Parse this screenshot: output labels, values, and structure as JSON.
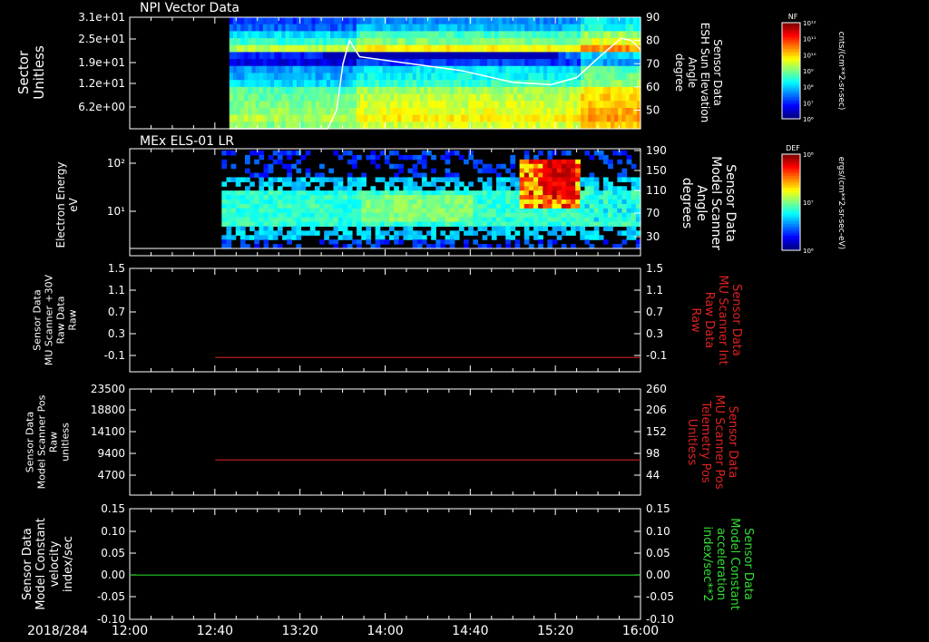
{
  "colors": {
    "background": "#000000",
    "frame": "#ffffff",
    "text": "#ffffff",
    "red_trace": "#cc2020",
    "green_trace": "#22cc22"
  },
  "time_axis": {
    "date_label": "2018/284",
    "ticks": [
      "12:00",
      "12:40",
      "13:20",
      "14:00",
      "14:40",
      "15:20",
      "16:00"
    ],
    "tick_hours": [
      12.0,
      12.6667,
      13.3333,
      14.0,
      14.6667,
      15.3333,
      16.0
    ],
    "range_hours": [
      12.0,
      16.0
    ]
  },
  "chart_data": [
    {
      "type": "heatmap",
      "title": "NPI Vector Data",
      "ylabel_left": [
        "Sector",
        "Unitless"
      ],
      "yticks_left": [
        "3.1e+01",
        "2.5e+01",
        "1.9e+01",
        "1.2e+01",
        "6.2e+00"
      ],
      "ylabel_right": [
        "Sensor Data",
        "ESH Sun Elevation",
        "Angle",
        "degree"
      ],
      "yticks_right": [
        "90",
        "80",
        "70",
        "60",
        "50"
      ],
      "ylim_right": [
        42,
        90
      ],
      "data_start_hour": 12.78,
      "overlay_line": {
        "name": "ESH Sun Elevation Angle",
        "color": "#ffffff",
        "x_hours": [
          12.78,
          13.3,
          13.55,
          13.62,
          13.67,
          13.72,
          13.8,
          14.2,
          14.6,
          15.0,
          15.3,
          15.5,
          15.7,
          15.85,
          15.93,
          16.0
        ],
        "y_degrees": [
          42,
          42,
          42,
          50,
          70,
          80,
          73,
          70,
          67,
          62,
          61,
          64,
          74,
          81,
          80,
          76
        ]
      },
      "colorbar": {
        "label": "NF",
        "tick_labels": [
          "10¹²",
          "10¹¹",
          "10¹⁰",
          "10⁹",
          "10⁸",
          "10⁷",
          "10⁶"
        ],
        "units": "cnts/(cm**2-sr-sec)"
      }
    },
    {
      "type": "heatmap",
      "title": "MEx ELS-01 LR",
      "ylabel_left": [
        "Electron Energy",
        "eV"
      ],
      "yticks_left": [
        "10²",
        "10¹"
      ],
      "ylabel_right": [
        "Sensor Data",
        "Model Scanner",
        "Angle",
        "degrees"
      ],
      "yticks_right": [
        "190",
        "150",
        "110",
        "70",
        "30"
      ],
      "data_start_hour": 12.72,
      "colorbar": {
        "label": "DEF",
        "tick_labels": [
          "10⁸",
          "10⁷",
          "10⁶"
        ],
        "units": "ergs/(cm**2-sr-sec-eV)"
      }
    },
    {
      "type": "line",
      "ylabel_left": [
        "Sensor Data",
        "MU Scanner +30V",
        "Raw Data",
        "Raw"
      ],
      "yticks_left": [
        "1.5",
        "1.1",
        "0.7",
        "0.3",
        "-0.1"
      ],
      "ylim_left": [
        -0.3,
        1.5
      ],
      "ylabel_right": [
        "Sensor Data",
        "MU Scanner Int",
        "Raw Data",
        "Raw"
      ],
      "yticks_right": [
        "1.5",
        "1.1",
        "0.7",
        "0.3",
        "-0.1"
      ],
      "series": [
        {
          "color": "#cc2020",
          "x_hours": [
            12.67,
            16.0
          ],
          "y": [
            -0.05,
            -0.05
          ]
        }
      ]
    },
    {
      "type": "line",
      "ylabel_left": [
        "Sensor Data",
        "Model Scanner Pos",
        "Raw",
        "unitless"
      ],
      "yticks_left": [
        "23500",
        "18800",
        "14100",
        "9400",
        "4700"
      ],
      "ylim_left": [
        0,
        23500
      ],
      "ylabel_right": [
        "Sensor Data",
        "MU Scanner Pos",
        "Telemetry Pos",
        "Unitless"
      ],
      "yticks_right": [
        "260",
        "206",
        "152",
        "98",
        "44"
      ],
      "series": [
        {
          "color": "#cc2020",
          "x_hours": [
            12.67,
            16.0
          ],
          "y": [
            7800,
            7800
          ]
        }
      ]
    },
    {
      "type": "line",
      "ylabel_left": [
        "Sensor Data",
        "Model Constant",
        "velocity",
        "index/sec"
      ],
      "yticks_left": [
        "0.15",
        "0.10",
        "0.05",
        "0.00",
        "-0.05",
        "-0.10"
      ],
      "ylim_left": [
        -0.1,
        0.15
      ],
      "ylabel_right": [
        "Sensor Data",
        "Model Constant",
        "acceleration",
        "index/sec**2"
      ],
      "yticks_right": [
        "0.15",
        "0.10",
        "0.05",
        "0.00",
        "-0.05",
        "-0.10"
      ],
      "series": [
        {
          "color": "#22cc22",
          "x_hours": [
            12.0,
            16.0
          ],
          "y": [
            0.0,
            0.0
          ]
        }
      ]
    }
  ]
}
